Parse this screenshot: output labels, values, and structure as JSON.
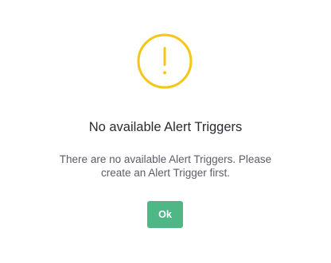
{
  "dialog": {
    "icon": "warning-exclamation-icon",
    "title": "No available Alert Triggers",
    "message_line1": "There are no available Alert Triggers. Please",
    "message_line2": "create an Alert Trigger first.",
    "ok_label": "Ok"
  },
  "colors": {
    "warning": "#f5c518",
    "ok_button": "#4fb785",
    "title_text": "#2b2b33",
    "message_text": "#5c5c66"
  }
}
